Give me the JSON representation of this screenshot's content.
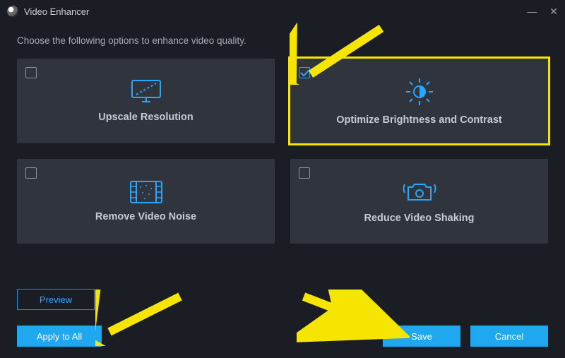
{
  "app": {
    "title": "Video Enhancer"
  },
  "instruction": "Choose the following options to enhance video quality.",
  "cards": {
    "upscale": {
      "label": "Upscale Resolution",
      "checked": false
    },
    "brightness": {
      "label": "Optimize Brightness and Contrast",
      "checked": true
    },
    "noise": {
      "label": "Remove Video Noise",
      "checked": false
    },
    "shaking": {
      "label": "Reduce Video Shaking",
      "checked": false
    }
  },
  "buttons": {
    "preview": "Preview",
    "apply_all": "Apply to All",
    "save": "Save",
    "cancel": "Cancel"
  },
  "colors": {
    "accent": "#1fa7f0",
    "highlight": "#f5e500"
  }
}
